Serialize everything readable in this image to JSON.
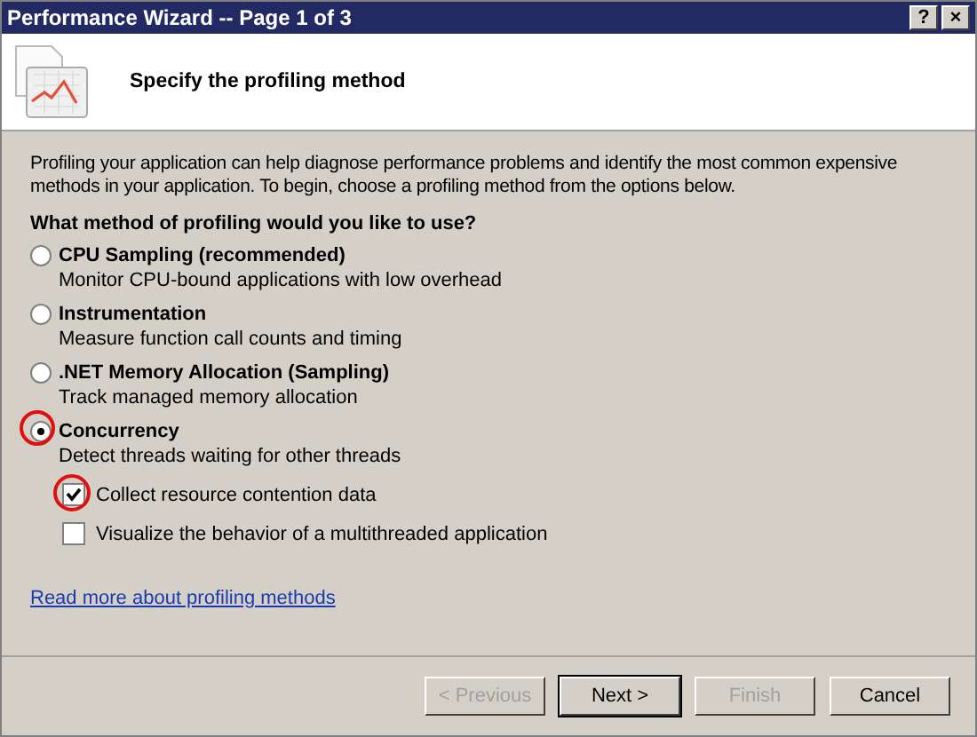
{
  "window": {
    "title": "Performance Wizard -- Page 1 of 3",
    "controls": [
      "?",
      "×"
    ]
  },
  "header": {
    "title": "Specify the profiling method"
  },
  "intro": "Profiling your application can help diagnose performance problems and identify the most common expensive methods in your application. To begin, choose a profiling method from the options below.",
  "question": "What method of profiling would you like to use?",
  "methods": [
    {
      "label": "CPU Sampling (recommended)",
      "description": "Monitor CPU-bound applications with low overhead",
      "selected": false,
      "highlighted": false
    },
    {
      "label": "Instrumentation",
      "description": "Measure function call counts and timing",
      "selected": false,
      "highlighted": false
    },
    {
      "label": ".NET Memory Allocation (Sampling)",
      "description": "Track managed memory allocation",
      "selected": false,
      "highlighted": false
    },
    {
      "label": "Concurrency",
      "description": "Detect threads waiting for other threads",
      "selected": true,
      "highlighted": true
    }
  ],
  "options": [
    {
      "label": "Collect resource contention data",
      "checked": true,
      "highlighted": true
    },
    {
      "label": "Visualize the behavior of a multithreaded application",
      "checked": false,
      "highlighted": false
    }
  ],
  "link": "Read more about profiling methods",
  "buttons": [
    {
      "label": "< Previous",
      "disabled": true,
      "default": false
    },
    {
      "label": "Next >",
      "disabled": false,
      "default": true
    },
    {
      "label": "Finish",
      "disabled": true,
      "default": false
    },
    {
      "label": "Cancel",
      "disabled": false,
      "default": false
    }
  ]
}
